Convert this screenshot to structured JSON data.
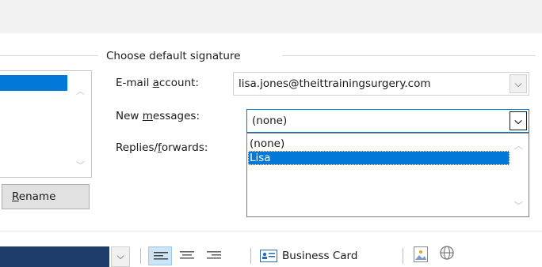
{
  "group": {
    "title": "Choose default signature"
  },
  "fields": {
    "email_account": {
      "label_pre": "E-mail ",
      "label_key": "a",
      "label_post": "ccount:",
      "value": "lisa.jones@theittrainingsurgery.com"
    },
    "new_messages": {
      "label_pre": "New ",
      "label_key": "m",
      "label_post": "essages:",
      "value": "(none)",
      "options": [
        "(none)",
        "Lisa"
      ],
      "highlighted": "Lisa"
    },
    "replies_forwards": {
      "label_pre": "Replies/",
      "label_key": "f",
      "label_post": "orwards:"
    }
  },
  "buttons": {
    "rename_key": "R",
    "rename_rest": "ename"
  },
  "toolbar": {
    "business_card": "Business Card"
  },
  "icons": {
    "dropdown": "chevron-down-icon",
    "scroll_up": "scroll-up-arrow-icon",
    "scroll_down": "scroll-down-arrow-icon",
    "align_left": "align-left-icon",
    "align_center": "align-center-icon",
    "align_right": "align-right-icon",
    "business_card": "business-card-icon",
    "picture": "insert-picture-icon",
    "hyperlink": "insert-hyperlink-icon"
  },
  "colors": {
    "accent": "#0078d7",
    "selection_text": "#ffffff",
    "button_face": "#e1e1e1",
    "titlebar": "#f2f2f2",
    "font_box": "#1f3d6b"
  }
}
